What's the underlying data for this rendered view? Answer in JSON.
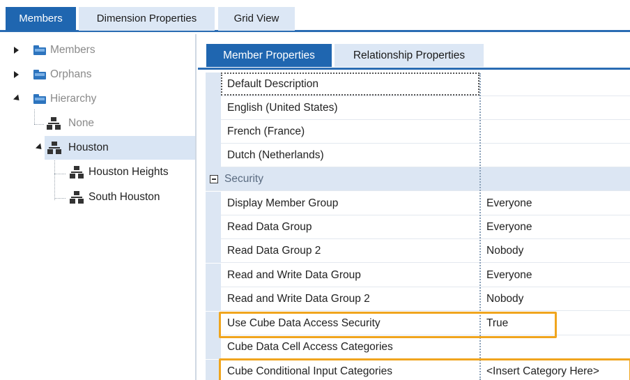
{
  "top_tabs": [
    "Members",
    "Dimension Properties",
    "Grid View"
  ],
  "tree": {
    "members": "Members",
    "orphans": "Orphans",
    "hierarchy": "Hierarchy",
    "none": "None",
    "houston": "Houston",
    "houston_heights": "Houston Heights",
    "south_houston": "South Houston"
  },
  "sub_tabs": [
    "Member Properties",
    "Relationship Properties"
  ],
  "properties": {
    "default_description": {
      "name": "Default Description",
      "value": ""
    },
    "english": {
      "name": "English (United States)",
      "value": ""
    },
    "french": {
      "name": "French (France)",
      "value": ""
    },
    "dutch": {
      "name": "Dutch (Netherlands)",
      "value": ""
    },
    "security_category": "Security",
    "display_member_group": {
      "name": "Display Member Group",
      "value": "Everyone"
    },
    "read_data_group": {
      "name": "Read Data Group",
      "value": "Everyone"
    },
    "read_data_group_2": {
      "name": "Read Data Group 2",
      "value": "Nobody"
    },
    "read_write_group": {
      "name": "Read and Write Data Group",
      "value": "Everyone"
    },
    "read_write_group_2": {
      "name": "Read and Write Data Group 2",
      "value": "Nobody"
    },
    "use_cube_security": {
      "name": "Use Cube Data Access Security",
      "value": "True"
    },
    "cube_cell_access": {
      "name": "Cube Data Cell Access Categories",
      "value": ""
    },
    "cube_conditional_input": {
      "name": "Cube Conditional Input Categories",
      "value": "<Insert Category Here>"
    }
  },
  "colors": {
    "accent": "#1f66b0",
    "tab_inactive": "#dce7f5",
    "highlight": "#f0a51e",
    "category_bg": "#dce6f3"
  }
}
